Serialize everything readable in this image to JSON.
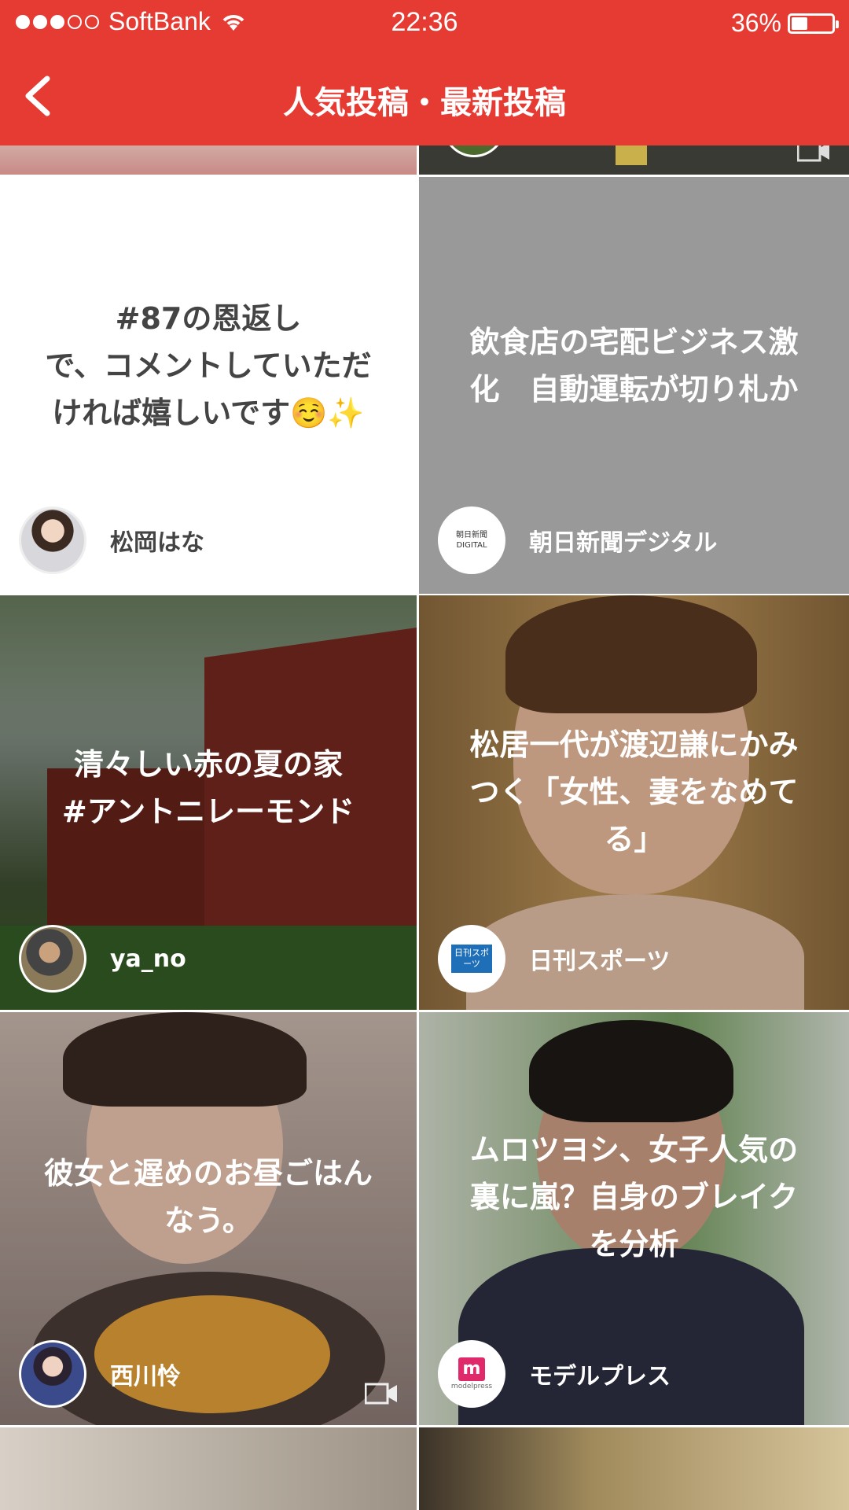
{
  "status_bar": {
    "carrier": "SoftBank",
    "time": "22:36",
    "battery": "36%"
  },
  "header": {
    "title": "人気投稿・最新投稿"
  },
  "posts": [
    {
      "text": "#87の恩返し\nで、コメントしていただ\nければ嬉しいです☺️✨",
      "author": "松岡はな"
    },
    {
      "text": "飲食店の宅配ビジネス激\n化　自動運転が切り札か",
      "author": "朝日新聞デジタル",
      "logo": "朝日新聞 DIGITAL"
    },
    {
      "text": "清々しい赤の夏の家\n#アントニレーモンド",
      "author": "ya_no"
    },
    {
      "text": "松居一代が渡辺謙にかみ\nつく「女性、妻をなめて\nる」",
      "author": "日刊スポーツ",
      "logo": "日刊スポーツ"
    },
    {
      "text": "彼女と遅めのお昼ごはん\nなう。",
      "author": "西川怜"
    },
    {
      "text": "ムロツヨシ、女子人気の\n裏に嵐？自身のブレイク\nを分析",
      "author": "モデルプレス",
      "logo": "modelpress"
    }
  ],
  "colors": {
    "accent": "#e63b33",
    "news_tile_bg": "#999999"
  }
}
